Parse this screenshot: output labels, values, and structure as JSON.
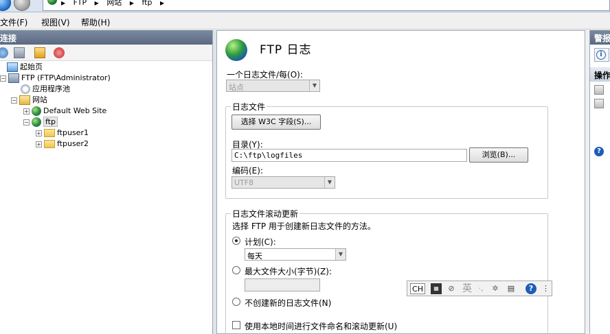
{
  "address_bar": {
    "breadcrumbs": [
      "FTP",
      "网站",
      "ftp"
    ]
  },
  "menu": {
    "items": [
      "文件(F)",
      "视图(V)",
      "帮助(H)"
    ]
  },
  "left_panel": {
    "title": "连接",
    "tree": [
      {
        "label": "起始页",
        "icon": "start-page-icon"
      },
      {
        "label": "FTP (FTP\\Administrator)",
        "icon": "server-icon"
      },
      {
        "label": "应用程序池",
        "icon": "app-pool-icon"
      },
      {
        "label": "网站",
        "icon": "sites-icon"
      },
      {
        "label": "Default Web Site",
        "icon": "globe-icon"
      },
      {
        "label": "ftp",
        "icon": "globe-icon"
      },
      {
        "label": "ftpuser1",
        "icon": "folder-icon"
      },
      {
        "label": "ftpuser2",
        "icon": "folder-icon"
      }
    ]
  },
  "main": {
    "title": "FTP 日志",
    "one_log_label": "一个日志文件/每(O):",
    "one_log_value": "站点",
    "log_file_group": "日志文件",
    "select_fields_button": "选择 W3C 字段(S)...",
    "directory_label": "目录(Y):",
    "directory_value": "C:\\ftp\\logfiles",
    "browse_button": "浏览(B)...",
    "encoding_label": "编码(E):",
    "encoding_value": "UTF8",
    "rollover_group": "日志文件滚动更新",
    "rollover_desc": "选择 FTP 用于创建新日志文件的方法。",
    "schedule_label": "计划(C):",
    "schedule_value": "每天",
    "max_size_label": "最大文件大小(字节)(Z):",
    "max_size_value": "",
    "no_new_label": "不创建新的日志文件(N)",
    "local_time_label": "使用本地时间进行文件命名和滚动更新(U)"
  },
  "ime": {
    "ch": "CH",
    "lang": "英"
  },
  "right_panel": {
    "title": "警报",
    "actions_title": "操作"
  }
}
